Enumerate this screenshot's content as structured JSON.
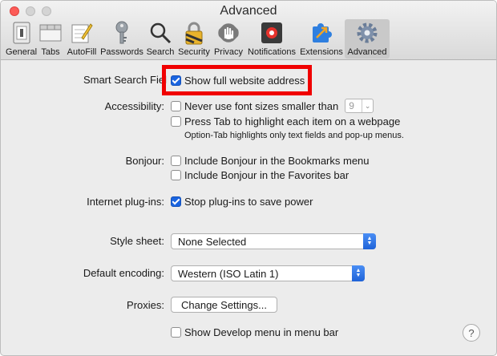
{
  "window": {
    "title": "Advanced"
  },
  "toolbar": {
    "items": [
      {
        "label": "General",
        "icon": "general-icon"
      },
      {
        "label": "Tabs",
        "icon": "tabs-icon"
      },
      {
        "label": "AutoFill",
        "icon": "autofill-icon"
      },
      {
        "label": "Passwords",
        "icon": "key-icon"
      },
      {
        "label": "Search",
        "icon": "search-icon"
      },
      {
        "label": "Security",
        "icon": "lock-icon"
      },
      {
        "label": "Privacy",
        "icon": "hand-icon"
      },
      {
        "label": "Notifications",
        "icon": "notification-icon"
      },
      {
        "label": "Extensions",
        "icon": "puzzle-icon"
      },
      {
        "label": "Advanced",
        "icon": "gear-icon"
      }
    ],
    "selected": "Advanced"
  },
  "smart_search": {
    "label": "Smart Search Field",
    "visible_label": "Smart Search Fiel",
    "show_full_address": {
      "label": "Show full website address",
      "checked": true
    }
  },
  "accessibility": {
    "label": "Accessibility:",
    "min_font": {
      "label": "Never use font sizes smaller than",
      "checked": false,
      "value": "9"
    },
    "press_tab": {
      "label": "Press Tab to highlight each item on a webpage",
      "checked": false
    },
    "note": "Option-Tab highlights only text fields and pop-up menus."
  },
  "bonjour": {
    "label": "Bonjour:",
    "bookmarks": {
      "label": "Include Bonjour in the Bookmarks menu",
      "checked": false
    },
    "favorites": {
      "label": "Include Bonjour in the Favorites bar",
      "checked": false
    }
  },
  "plugins": {
    "label": "Internet plug-ins:",
    "stop": {
      "label": "Stop plug-ins to save power",
      "checked": true
    }
  },
  "style_sheet": {
    "label": "Style sheet:",
    "value": "None Selected"
  },
  "encoding": {
    "label": "Default encoding:",
    "value": "Western (ISO Latin 1)"
  },
  "proxies": {
    "label": "Proxies:",
    "button": "Change Settings..."
  },
  "develop": {
    "label": "Show Develop menu in menu bar",
    "checked": false
  },
  "help": {
    "glyph": "?"
  },
  "colors": {
    "accent": "#1a64e0",
    "highlight": "#f00000",
    "close": "#fc5b57"
  }
}
